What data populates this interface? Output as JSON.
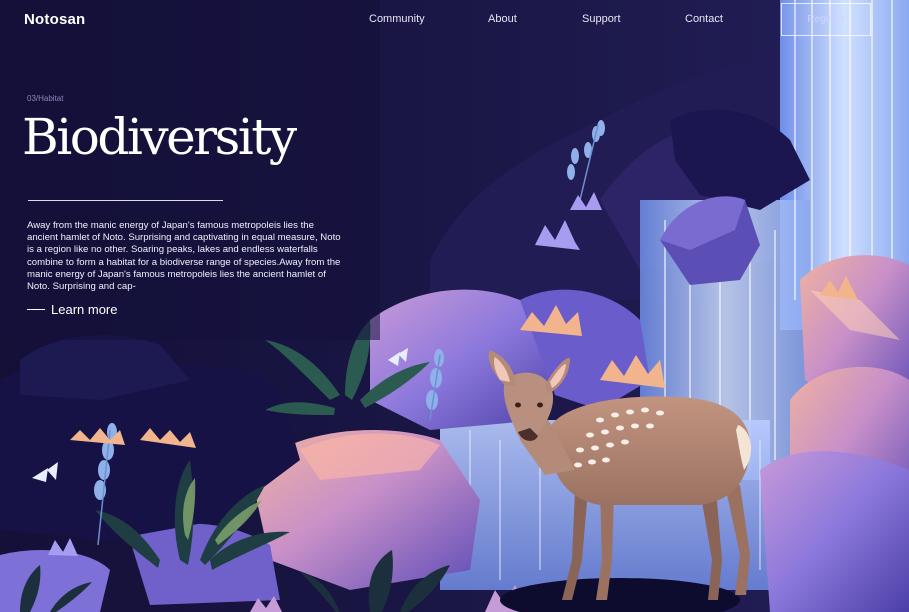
{
  "brand": "Notosan",
  "nav": {
    "links": [
      "Community",
      "About",
      "Support",
      "Contact"
    ],
    "register": "Register"
  },
  "hero": {
    "kicker": "03/Habitat",
    "title": "Biodiversity",
    "description": "Away from the manic energy of Japan's famous metropoleis lies the ancient hamlet of Noto. Surprising and captivating in equal measure, Noto is a region like no other. Soaring peaks, lakes and endless waterfalls combine to form a habitat for a biodiverse range of species.Away from the manic energy of Japan's famous metropoleis lies the ancient hamlet of Noto. Surprising and cap-",
    "cta": "Learn more"
  },
  "colors": {
    "background": "#14113a",
    "waterfall": "#a8c8ff",
    "rock": "#7d6fd6",
    "deer": "#b48a78"
  }
}
